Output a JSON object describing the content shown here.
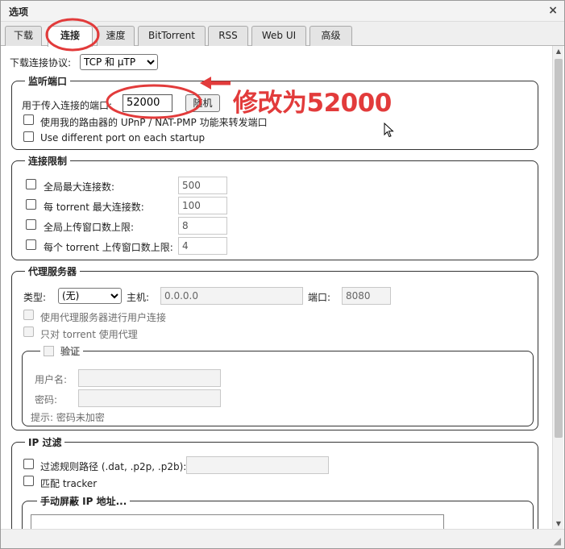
{
  "window": {
    "title": "选项",
    "close": "×"
  },
  "tabs": [
    "下载",
    "连接",
    "速度",
    "BitTorrent",
    "RSS",
    "Web UI",
    "高级"
  ],
  "protocol": {
    "label": "下载连接协议:",
    "value": "TCP 和 μTP"
  },
  "listening_port": {
    "legend": "监听端口",
    "port_label": "用于传入连接的端口:",
    "port_value": "52000",
    "random_button": "随机",
    "upnp_label": "使用我的路由器的 UPnP / NAT-PMP 功能来转发端口",
    "random_startup_label": "Use different port on each startup"
  },
  "annotation": {
    "text": "修改为52000",
    "color": "#e23b3b"
  },
  "connection_limits": {
    "legend": "连接限制",
    "rows": [
      {
        "label": "全局最大连接数:",
        "value": "500"
      },
      {
        "label": "每 torrent 最大连接数:",
        "value": "100"
      },
      {
        "label": "全局上传窗口数上限:",
        "value": "8"
      },
      {
        "label": "每个 torrent 上传窗口数上限:",
        "value": "4"
      }
    ]
  },
  "proxy": {
    "legend": "代理服务器",
    "type_label": "类型:",
    "type_value": "(无)",
    "host_label": "主机:",
    "host_value": "0.0.0.0",
    "port_label": "端口:",
    "port_value": "8080",
    "peer_label": "使用代理服务器进行用户连接",
    "torrent_only_label": "只对 torrent 使用代理",
    "auth": {
      "legend": "验证",
      "username_label": "用户名:",
      "password_label": "密码:",
      "hint": "提示: 密码未加密"
    }
  },
  "ip_filter": {
    "legend": "IP 过滤",
    "path_label": "过滤规则路径 (.dat, .p2p, .p2b):",
    "tracker_label": "匹配 tracker",
    "manual_legend": "手动屏蔽 IP 地址..."
  }
}
